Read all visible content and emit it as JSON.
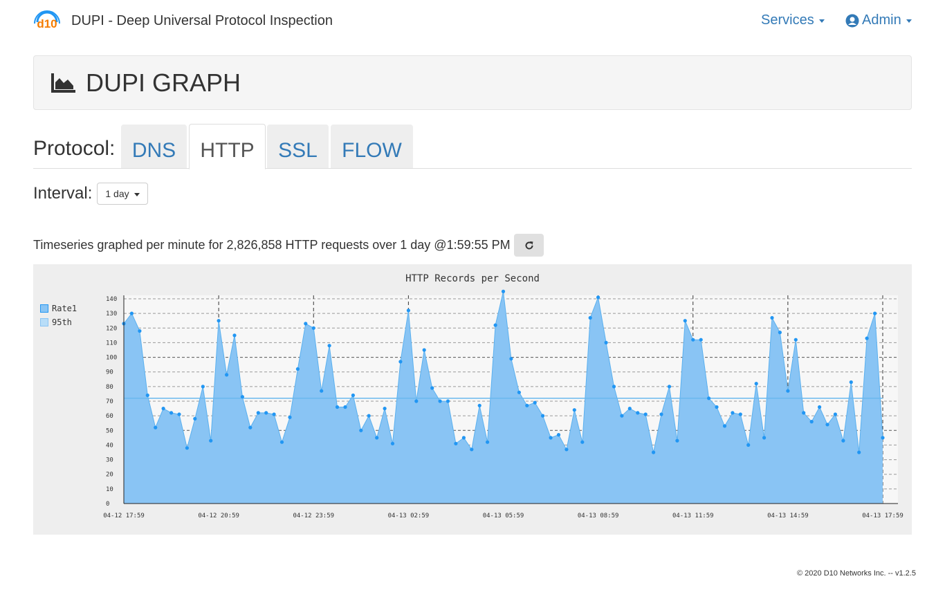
{
  "nav": {
    "brand": "DUPI - Deep Universal Protocol Inspection",
    "logo_text": "d10",
    "services": "Services",
    "admin": "Admin"
  },
  "header": {
    "title": "DUPI GRAPH",
    "icon": "area-chart-icon"
  },
  "protocol": {
    "label": "Protocol:",
    "tabs": [
      "DNS",
      "HTTP",
      "SSL",
      "FLOW"
    ],
    "active": "HTTP"
  },
  "interval": {
    "label": "Interval:",
    "value": "1 day"
  },
  "summary": "Timeseries graphed per minute for 2,826,858 HTTP requests over 1 day @1:59:55 PM",
  "footer": "© 2020 D10 Networks Inc. -- v1.2.5",
  "colors": {
    "accent": "#337ab7",
    "area": "#89c4f4",
    "line": "#2196f3",
    "p95": "#6ab8ee"
  },
  "chart_data": {
    "type": "area",
    "title": "HTTP Records per Second",
    "legend": [
      "Rate1",
      "95th"
    ],
    "legend_position": "left",
    "ylim": [
      0,
      140
    ],
    "yticks": [
      0,
      10,
      20,
      30,
      40,
      50,
      60,
      70,
      80,
      90,
      100,
      110,
      120,
      130,
      140
    ],
    "xticks": [
      "04-12 17:59",
      "04-12 20:59",
      "04-12 23:59",
      "04-13 02:59",
      "04-13 05:59",
      "04-13 08:59",
      "04-13 11:59",
      "04-13 14:59",
      "04-13 17:59"
    ],
    "p95": 72,
    "series": [
      {
        "name": "Rate1",
        "values": [
          123,
          130,
          118,
          74,
          52,
          65,
          62,
          61,
          38,
          58,
          80,
          43,
          125,
          88,
          115,
          73,
          52,
          62,
          62,
          61,
          42,
          59,
          92,
          123,
          120,
          77,
          108,
          66,
          66,
          74,
          50,
          60,
          45,
          65,
          41,
          97,
          132,
          70,
          105,
          79,
          70,
          70,
          41,
          45,
          37,
          67,
          42,
          122,
          145,
          99,
          76,
          67,
          69,
          60,
          45,
          47,
          37,
          64,
          42,
          127,
          141,
          110,
          80,
          60,
          65,
          62,
          61,
          35,
          61,
          80,
          43,
          125,
          112,
          112,
          72,
          66,
          53,
          62,
          61,
          40,
          82,
          45,
          127,
          117,
          77,
          112,
          62,
          56,
          66,
          54,
          61,
          43,
          83,
          35,
          113,
          130,
          45
        ]
      }
    ]
  }
}
